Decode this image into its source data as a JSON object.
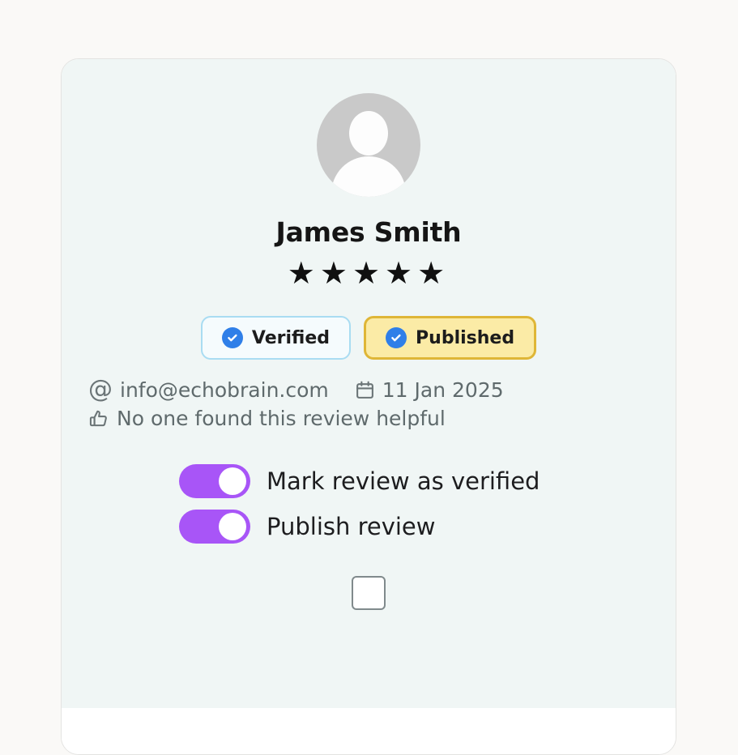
{
  "page": {
    "background_color": "#faf9f7"
  },
  "card": {
    "background_color": "#f0f6f5",
    "border_color": "#e3e3e1",
    "reviewer": {
      "name": "James Smith",
      "avatar_icon": "user-avatar-placeholder-icon",
      "avatar_color": "#c9c9c9"
    },
    "rating": {
      "value": 5,
      "max": 5,
      "star_glyph": "★",
      "star_color": "#101010"
    },
    "badges": [
      {
        "label": "Verified",
        "icon": "blue-check-circle-icon",
        "background_color": "#f5fbfd",
        "border_color": "#a9dcf2",
        "icon_color": "#2f7fe8"
      },
      {
        "label": "Published",
        "icon": "blue-check-circle-icon",
        "background_color": "#fbeba6",
        "border_color": "#dfb637",
        "icon_color": "#2f7fe8"
      }
    ],
    "meta": {
      "email": "info@echobrain.com",
      "email_icon": "at-sign-icon",
      "date": "11 Jan 2025",
      "date_icon": "calendar-icon",
      "helpful_text": "No one found this review helpful",
      "helpful_icon": "thumbs-up-icon",
      "text_color": "#5f6a6c"
    },
    "toggles": [
      {
        "label": "Mark review as verified",
        "state": "on",
        "track_color": "#a855f7"
      },
      {
        "label": "Publish review",
        "state": "on",
        "track_color": "#a855f7"
      }
    ],
    "checkbox": {
      "state": "unchecked",
      "border_color": "#808a8c"
    }
  }
}
